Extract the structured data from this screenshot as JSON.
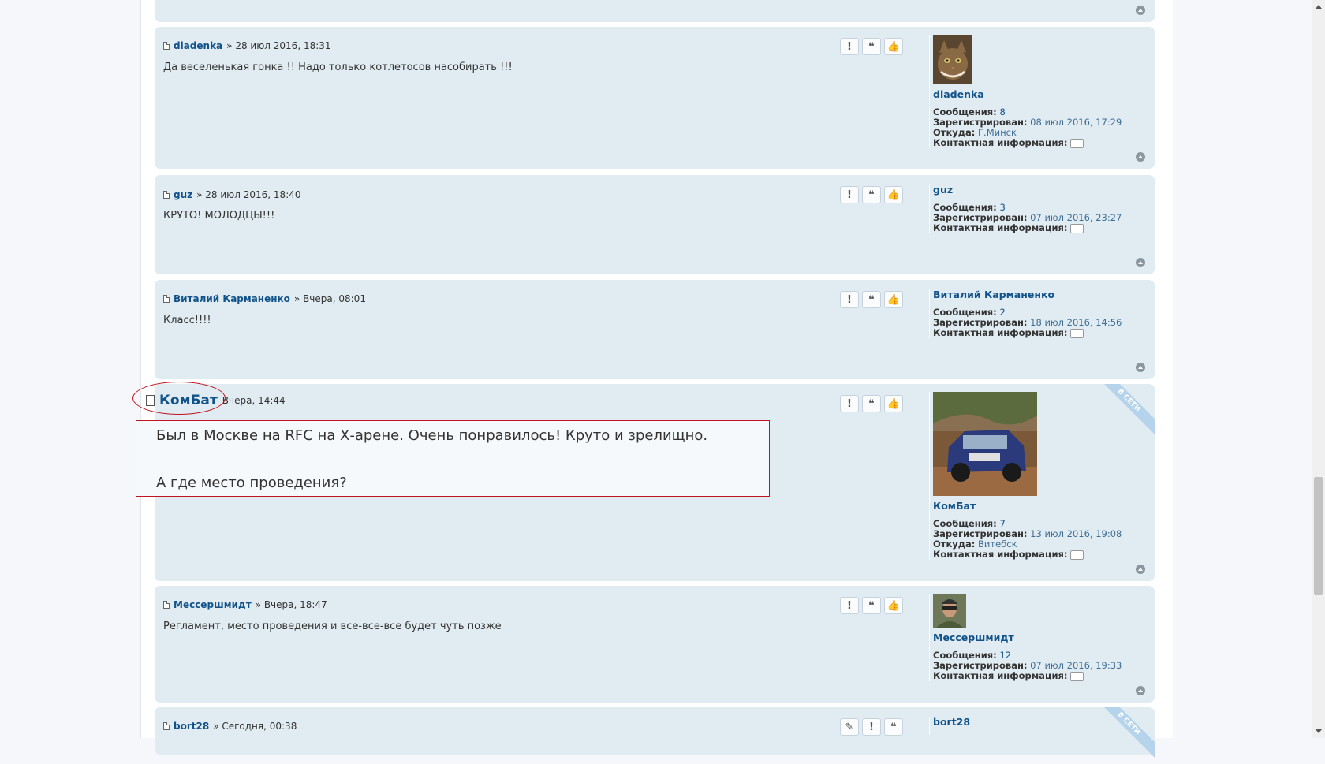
{
  "posts": [
    {
      "author": "dladenka",
      "date": "» 28 июл 2016, 18:31",
      "text": "Да веселенькая гонка !! Надо только котлетосов насобирать !!!",
      "profile": {
        "name": "dladenka",
        "posts_label": "Сообщения:",
        "posts_value": "8",
        "reg_label": "Зарегистрирован:",
        "reg_value": "08 июл 2016, 17:29",
        "from_label": "Откуда:",
        "from_value": "Г.Минск",
        "contact_label": "Контактная информация:"
      }
    },
    {
      "author": "guz",
      "date": "» 28 июл 2016, 18:40",
      "text": "КРУТО! МОЛОДЦЫ!!!",
      "profile": {
        "name": "guz",
        "posts_label": "Сообщения:",
        "posts_value": "3",
        "reg_label": "Зарегистрирован:",
        "reg_value": "07 июл 2016, 23:27",
        "contact_label": "Контактная информация:"
      }
    },
    {
      "author": "Виталий Карманенко",
      "date": "» Вчера, 08:01",
      "text": "Класс!!!!",
      "profile": {
        "name": "Виталий Карманенко",
        "posts_label": "Сообщения:",
        "posts_value": "2",
        "reg_label": "Зарегистрирован:",
        "reg_value": "18 июл 2016, 14:56",
        "contact_label": "Контактная информация:"
      }
    },
    {
      "author": "КомБат",
      "date": "Вчера, 14:44",
      "text_line1": "Был в Москве на RFC на Х-арене. Очень понравилось! Круто и зрелищно.",
      "text_line2": "А где место проведения?",
      "online": "В СЕТИ",
      "profile": {
        "name": "КомБат",
        "posts_label": "Сообщения:",
        "posts_value": "7",
        "reg_label": "Зарегистрирован:",
        "reg_value": "13 июл 2016, 19:08",
        "from_label": "Откуда:",
        "from_value": "Витебск",
        "contact_label": "Контактная информация:"
      }
    },
    {
      "author": "Мессершмидт",
      "date": "» Вчера, 18:47",
      "text": "Регламент, место проведения и все-все-все будет чуть позже",
      "profile": {
        "name": "Мессершмидт",
        "posts_label": "Сообщения:",
        "posts_value": "12",
        "reg_label": "Зарегистрирован:",
        "reg_value": "07 июл 2016, 19:33",
        "contact_label": "Контактная информация:"
      }
    },
    {
      "author": "bort28",
      "date": "» Сегодня, 00:38",
      "online": "В СЕТИ",
      "profile": {
        "name": "bort28"
      }
    }
  ],
  "buttons": {
    "report": "!",
    "quote": "❝",
    "like": "👍",
    "edit": "✎"
  }
}
